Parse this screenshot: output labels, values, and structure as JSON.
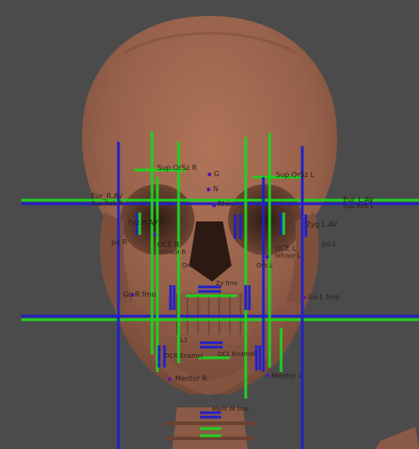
{
  "viewport": {
    "background": "#4b4b4b",
    "model": "skull-3d-render",
    "skull_color": "#9a634b"
  },
  "guide_colors": {
    "green": "#1fd11f",
    "blue": "#2121c8",
    "point": "#5a1aa8"
  },
  "landmarks": {
    "g": "G",
    "n": "N",
    "sup_or_sz_r": "Sup.OrSz R",
    "sup_or_sz_l": "Sup.OrSz L",
    "eur_r_av": "Eur_R.AV",
    "eur_l_av": "Eur_L.AV",
    "sup_reb_r": "Sup.Reb R",
    "sup_reb_l": "Sup.Reb L",
    "rhin": "Rhin",
    "zyg_l_av": "Zyg L.AV",
    "fyz_r_av": "Fyz R.AV",
    "po_r": "po R",
    "po_l": "po L",
    "oce_r": "OCE R",
    "oce_l": "OCE L",
    "infraor_r": "Infraor R",
    "infraor_l": "Infraor L",
    "orb_r": "Orb R",
    "orb_l": "Orb L",
    "go_r_fmo": "Go R fmo",
    "go_l_fmo": "Go L fmo",
    "zygion_fmo": "Zy fmo",
    "lr_1": "L1",
    "ocr_enamel": "OCR Enamel",
    "ocr_l_enamel": "OCL Enamel",
    "mentor_r": "Mentor R",
    "mentor_l": "Mentor L",
    "ment_m_fmo": "Ment M fmo"
  }
}
